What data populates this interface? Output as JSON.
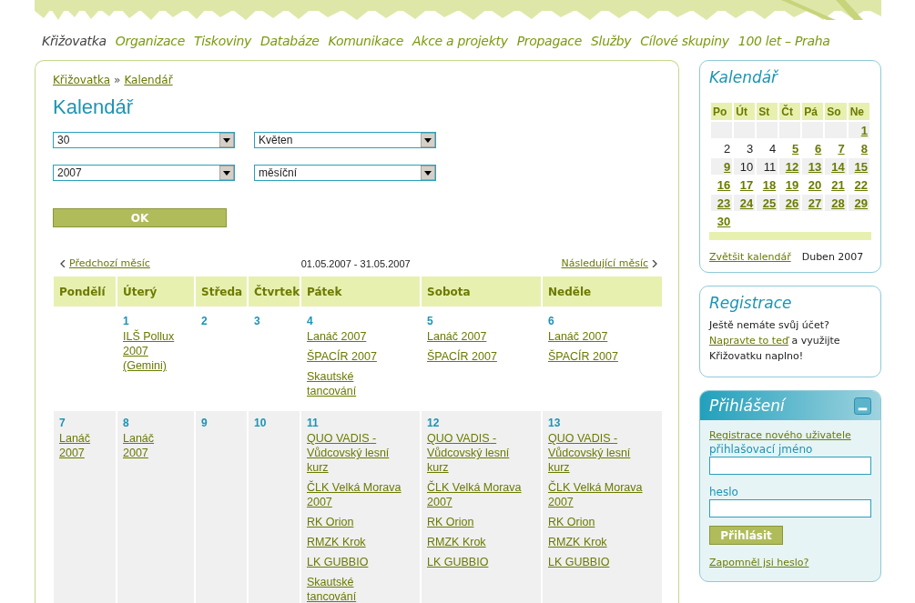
{
  "nav": [
    {
      "label": "Křižovatka",
      "selected": true
    },
    {
      "label": "Organizace",
      "selected": false
    },
    {
      "label": "Tiskoviny",
      "selected": false
    },
    {
      "label": "Databáze",
      "selected": false
    },
    {
      "label": "Komunikace",
      "selected": false
    },
    {
      "label": "Akce a projekty",
      "selected": false
    },
    {
      "label": "Propagace",
      "selected": false
    },
    {
      "label": "Služby",
      "selected": false
    },
    {
      "label": "Cílové skupiny",
      "selected": false
    },
    {
      "label": "100 let – Praha",
      "selected": false
    }
  ],
  "breadcrumb": [
    "Křižovatka",
    "Kalendář"
  ],
  "breadcrumb_separator": "»",
  "page_title": "Kalendář",
  "filters": [
    {
      "value": "30"
    },
    {
      "value": "Květen"
    },
    {
      "value": "2007"
    },
    {
      "value": "měsíční"
    }
  ],
  "ok_button": "OK",
  "prev_link": "Předchozí měsíc",
  "range": "01.05.2007 - 31.05.2007",
  "next_link": "Následující měsíc",
  "columns": [
    "Pondělí",
    "Úterý",
    "Středa",
    "Čtvrtek",
    "Pátek",
    "Sobota",
    "Neděle"
  ],
  "weeks": [
    {
      "shaded": false,
      "days": [
        {
          "kind": "empty"
        },
        {
          "kind": "day",
          "number": "1",
          "events": [
            "ILŠ Pollux 2007 (Gemini)"
          ]
        },
        {
          "kind": "day",
          "number": "2"
        },
        {
          "kind": "day",
          "number": "3"
        },
        {
          "kind": "day",
          "number": "4",
          "events": [
            "Lanáč 2007",
            "ŠPACÍR 2007",
            "Skautské tancování"
          ]
        },
        {
          "kind": "day",
          "number": "5",
          "events": [
            "Lanáč 2007",
            "ŠPACÍR 2007"
          ]
        },
        {
          "kind": "day",
          "number": "6",
          "events": [
            "Lanáč 2007",
            "ŠPACÍR 2007"
          ]
        }
      ]
    },
    {
      "shaded": true,
      "days": [
        {
          "kind": "day",
          "number": "7",
          "events": [
            "Lanáč 2007"
          ]
        },
        {
          "kind": "day",
          "number": "8",
          "events": [
            "Lanáč 2007"
          ]
        },
        {
          "kind": "day",
          "number": "9"
        },
        {
          "kind": "day",
          "number": "10"
        },
        {
          "kind": "day",
          "number": "11",
          "events": [
            "QUO VADIS - Vůdcovský lesní kurz",
            "ČLK Velká Morava 2007",
            "RK Orion",
            "RMZK Krok",
            "LK GUBBIO",
            "Skautské tancování"
          ]
        },
        {
          "kind": "day",
          "number": "12",
          "events": [
            "QUO VADIS - Vůdcovský lesní kurz",
            "ČLK Velká Morava 2007",
            "RK Orion",
            "RMZK Krok",
            "LK GUBBIO"
          ]
        },
        {
          "kind": "day",
          "number": "13",
          "events": [
            "QUO VADIS - Vůdcovský lesní kurz",
            "ČLK Velká Morava 2007",
            "RK Orion",
            "RMZK Krok",
            "LK GUBBIO"
          ]
        }
      ]
    }
  ],
  "mini_calendar": {
    "title": "Kalendář",
    "columns": [
      "Po",
      "Út",
      "St",
      "Čt",
      "Pá",
      "So",
      "Ne"
    ],
    "weeks": [
      [
        {
          "kind": "empty"
        },
        {
          "kind": "empty"
        },
        {
          "kind": "empty"
        },
        {
          "kind": "empty"
        },
        {
          "kind": "empty"
        },
        {
          "kind": "empty"
        },
        {
          "kind": "day",
          "number": "1",
          "linked": true
        }
      ],
      [
        {
          "kind": "day",
          "number": "2",
          "linked": false
        },
        {
          "kind": "day",
          "number": "3",
          "linked": false
        },
        {
          "kind": "day",
          "number": "4",
          "linked": false
        },
        {
          "kind": "day",
          "number": "5",
          "linked": true
        },
        {
          "kind": "day",
          "number": "6",
          "linked": true
        },
        {
          "kind": "day",
          "number": "7",
          "linked": true
        },
        {
          "kind": "day",
          "number": "8",
          "linked": true
        }
      ],
      [
        {
          "kind": "day",
          "number": "9",
          "linked": true
        },
        {
          "kind": "day",
          "number": "10",
          "linked": false
        },
        {
          "kind": "day",
          "number": "11",
          "linked": false
        },
        {
          "kind": "day",
          "number": "12",
          "linked": true
        },
        {
          "kind": "day",
          "number": "13",
          "linked": true
        },
        {
          "kind": "day",
          "number": "14",
          "linked": true
        },
        {
          "kind": "day",
          "number": "15",
          "linked": true
        }
      ],
      [
        {
          "kind": "day",
          "number": "16",
          "linked": true
        },
        {
          "kind": "day",
          "number": "17",
          "linked": true
        },
        {
          "kind": "day",
          "number": "18",
          "linked": true
        },
        {
          "kind": "day",
          "number": "19",
          "linked": true
        },
        {
          "kind": "day",
          "number": "20",
          "linked": true
        },
        {
          "kind": "day",
          "number": "21",
          "linked": true
        },
        {
          "kind": "day",
          "number": "22",
          "linked": true
        }
      ],
      [
        {
          "kind": "day",
          "number": "23",
          "linked": true
        },
        {
          "kind": "day",
          "number": "24",
          "linked": true
        },
        {
          "kind": "day",
          "number": "25",
          "linked": true
        },
        {
          "kind": "day",
          "number": "26",
          "linked": true
        },
        {
          "kind": "day",
          "number": "27",
          "linked": true
        },
        {
          "kind": "day",
          "number": "28",
          "linked": true
        },
        {
          "kind": "day",
          "number": "29",
          "linked": true
        }
      ],
      [
        {
          "kind": "day",
          "number": "30",
          "linked": true
        }
      ]
    ],
    "enlarge_link": "Zvětšit kalendář",
    "month": "Duben 2007"
  },
  "registration": {
    "title": "Registrace",
    "question": "Ještě nemáte svůj účet?",
    "link": "Napravte to teď",
    "rest": "a využijte Křižovatku naplno!"
  },
  "login": {
    "title": "Přihlášení",
    "register_link": "Registrace nového uživatele",
    "username_label": "přihlašovací jméno",
    "password_label": "heslo",
    "submit": "Přihlásit",
    "forgot_link": "Zapomněl jsi heslo?"
  }
}
